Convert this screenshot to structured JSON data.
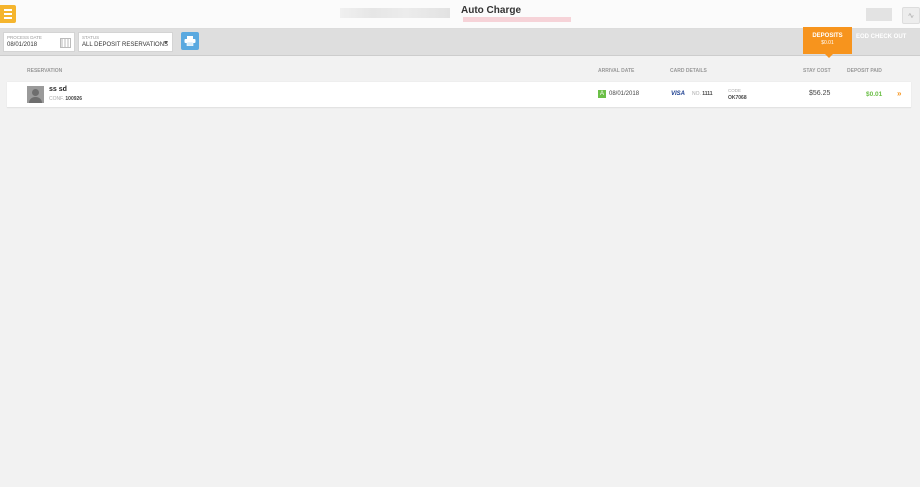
{
  "header": {
    "title": "Auto Charge",
    "menu_icon": "hamburger-icon",
    "right_icon": "pulse-icon"
  },
  "filters": {
    "process_date_label": "PROCESS DATE",
    "process_date_value": "08/01/2018",
    "status_label": "STATUS",
    "status_value": "ALL DEPOSIT RESERVATIONS",
    "print_icon": "printer-icon"
  },
  "tabs": {
    "deposits_label": "DEPOSITS",
    "deposits_amount": "$0.01",
    "eod_label": "EOD CHECK OUT"
  },
  "columns": {
    "reservation": "RESERVATION",
    "arrival_date": "ARRIVAL DATE",
    "card_details": "CARD DETAILS",
    "stay_cost": "STAY COST",
    "deposit_paid": "DEPOSIT PAID"
  },
  "rows": [
    {
      "guest_name": "ss sd",
      "conf_label": "CONF.",
      "conf_number": "100926",
      "arrival_badge": "A",
      "arrival_date": "08/01/2018",
      "card_brand": "VISA",
      "card_no_label": "NO.",
      "card_no": "1111",
      "code_label": "CODE",
      "code_value": "OK7068",
      "stay_cost": "$56.25",
      "deposit_paid": "$0.01",
      "action": "»"
    }
  ],
  "colors": {
    "accent_orange": "#f7941d",
    "menu_yellow": "#f5b52e",
    "paid_green": "#6bbf47",
    "print_blue": "#5aa9e0"
  }
}
